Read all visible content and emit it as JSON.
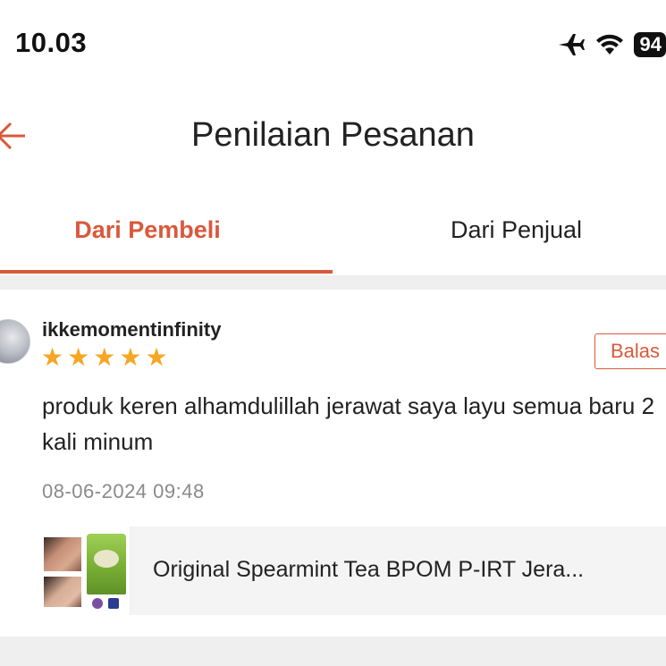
{
  "status_bar": {
    "time": "10.03",
    "battery": "94",
    "icons": [
      "airplane-icon",
      "wifi-icon",
      "battery-icon"
    ]
  },
  "header": {
    "title": "Penilaian Pesanan",
    "back_icon": "arrow-left-icon"
  },
  "tabs": [
    {
      "label": "Dari Pembeli",
      "active": true
    },
    {
      "label": "Dari Penjual",
      "active": false
    }
  ],
  "review": {
    "username": "ikkemomentinfinity",
    "rating": 5,
    "stars": [
      "★",
      "★",
      "★",
      "★",
      "★"
    ],
    "reply_label": "Balas",
    "comment": "produk keren alhamdulillah jerawat saya layu semua baru 2 kali minum",
    "timestamp": "08-06-2024 09:48",
    "product": {
      "name": "Original Spearmint Tea BPOM P-IRT Jera..."
    }
  },
  "colors": {
    "accent": "#d9593b",
    "star": "#f5a623",
    "muted_text": "#8a8a8a",
    "band": "#efefef"
  }
}
